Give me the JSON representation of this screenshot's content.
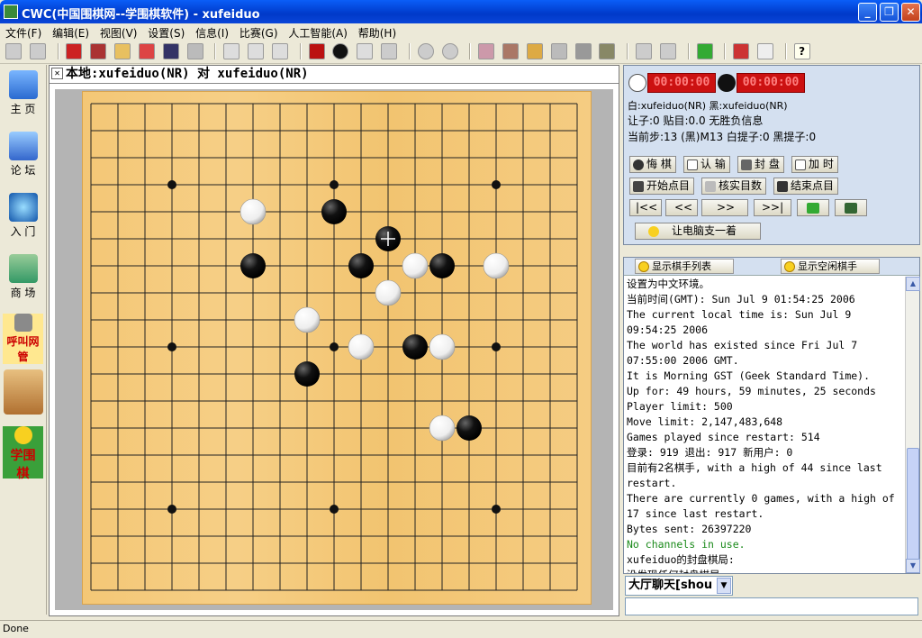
{
  "window": {
    "title": "CWC(中国围棋网--学围棋软件) - xufeiduo"
  },
  "menu": [
    "文件(F)",
    "编辑(E)",
    "视图(V)",
    "设置(S)",
    "信息(I)",
    "比赛(G)",
    "人工智能(A)",
    "帮助(H)"
  ],
  "sidebar": [
    {
      "label": "主 页",
      "icon": "home-icon"
    },
    {
      "label": "论 坛",
      "icon": "forum-icon"
    },
    {
      "label": "入 门",
      "icon": "globe-icon"
    },
    {
      "label": "商 场",
      "icon": "shop-icon"
    },
    {
      "label": "呼叫网管",
      "icon": "megaphone-icon"
    },
    {
      "label": "",
      "icon": "go-bowl-icon"
    },
    {
      "label": "学围棋",
      "icon": "smiley-icon"
    }
  ],
  "board": {
    "header": "本地:xufeiduo(NR) 对 xufeiduo(NR)",
    "size": 19,
    "hoshi": [
      [
        3,
        3
      ],
      [
        3,
        9
      ],
      [
        3,
        15
      ],
      [
        9,
        3
      ],
      [
        9,
        9
      ],
      [
        9,
        15
      ],
      [
        15,
        3
      ],
      [
        15,
        9
      ],
      [
        15,
        15
      ]
    ],
    "black": [
      [
        9,
        4
      ],
      [
        11,
        5
      ],
      [
        13,
        6
      ],
      [
        12,
        9
      ],
      [
        8,
        10
      ],
      [
        14,
        12
      ],
      [
        6,
        6
      ],
      [
        10,
        6
      ]
    ],
    "white": [
      [
        6,
        4
      ],
      [
        11,
        7
      ],
      [
        8,
        8
      ],
      [
        10,
        9
      ],
      [
        12,
        6
      ],
      [
        13,
        9
      ],
      [
        15,
        6
      ],
      [
        13,
        12
      ]
    ],
    "last_move": [
      11,
      5
    ]
  },
  "players": {
    "white_clock": "00:00:00",
    "black_clock": "00:00:00",
    "names_line": "白:xufeiduo(NR) 黑:xufeiduo(NR)",
    "rules_line": "让子:0 贴目:0.0 无胜负信息",
    "move_line": "当前步:13 (黑)M13 白提子:0 黑提子:0"
  },
  "controls": {
    "undo": "悔 棋",
    "resign": "认 输",
    "seal": "封 盘",
    "addtime": "加 时",
    "start_count": "开始点目",
    "verify_count": "核实目数",
    "end_count": "结束点目",
    "first": "|<<",
    "prev10": "<<",
    "next10": ">>",
    "last": ">>|",
    "computer_move": "让电脑支一着"
  },
  "chat": {
    "tab_players": "显示棋手列表",
    "tab_idle": "显示空闲棋手",
    "lines": [
      "设置为中文环境。",
      "当前时间(GMT):   Sun Jul  9 01:54:25 2006",
      "The current local time is:  Sun Jul  9",
      "09:54:25 2006",
      "The world has existed since Fri Jul  7",
      "07:55:00 2006 GMT.",
      "It is Morning GST (Geek Standard Time).",
      "Up for: 49 hours, 59 minutes, 25 seconds",
      "Player limit: 500",
      "Move limit: 2,147,483,648",
      "Games played since restart: 514",
      "登录: 919   退出: 917   新用户: 0",
      "目前有2名棋手, with a high of 44 since last",
      "restart.",
      "There are currently 0 games, with a high of",
      "17 since last restart.",
      "Bytes sent: 26397220",
      "No channels in use.",
      "xufeiduo的封盘棋局:",
      "没发现任何封盘棋局"
    ],
    "channel": "大厅聊天[shou"
  },
  "status": {
    "text": "Done"
  }
}
